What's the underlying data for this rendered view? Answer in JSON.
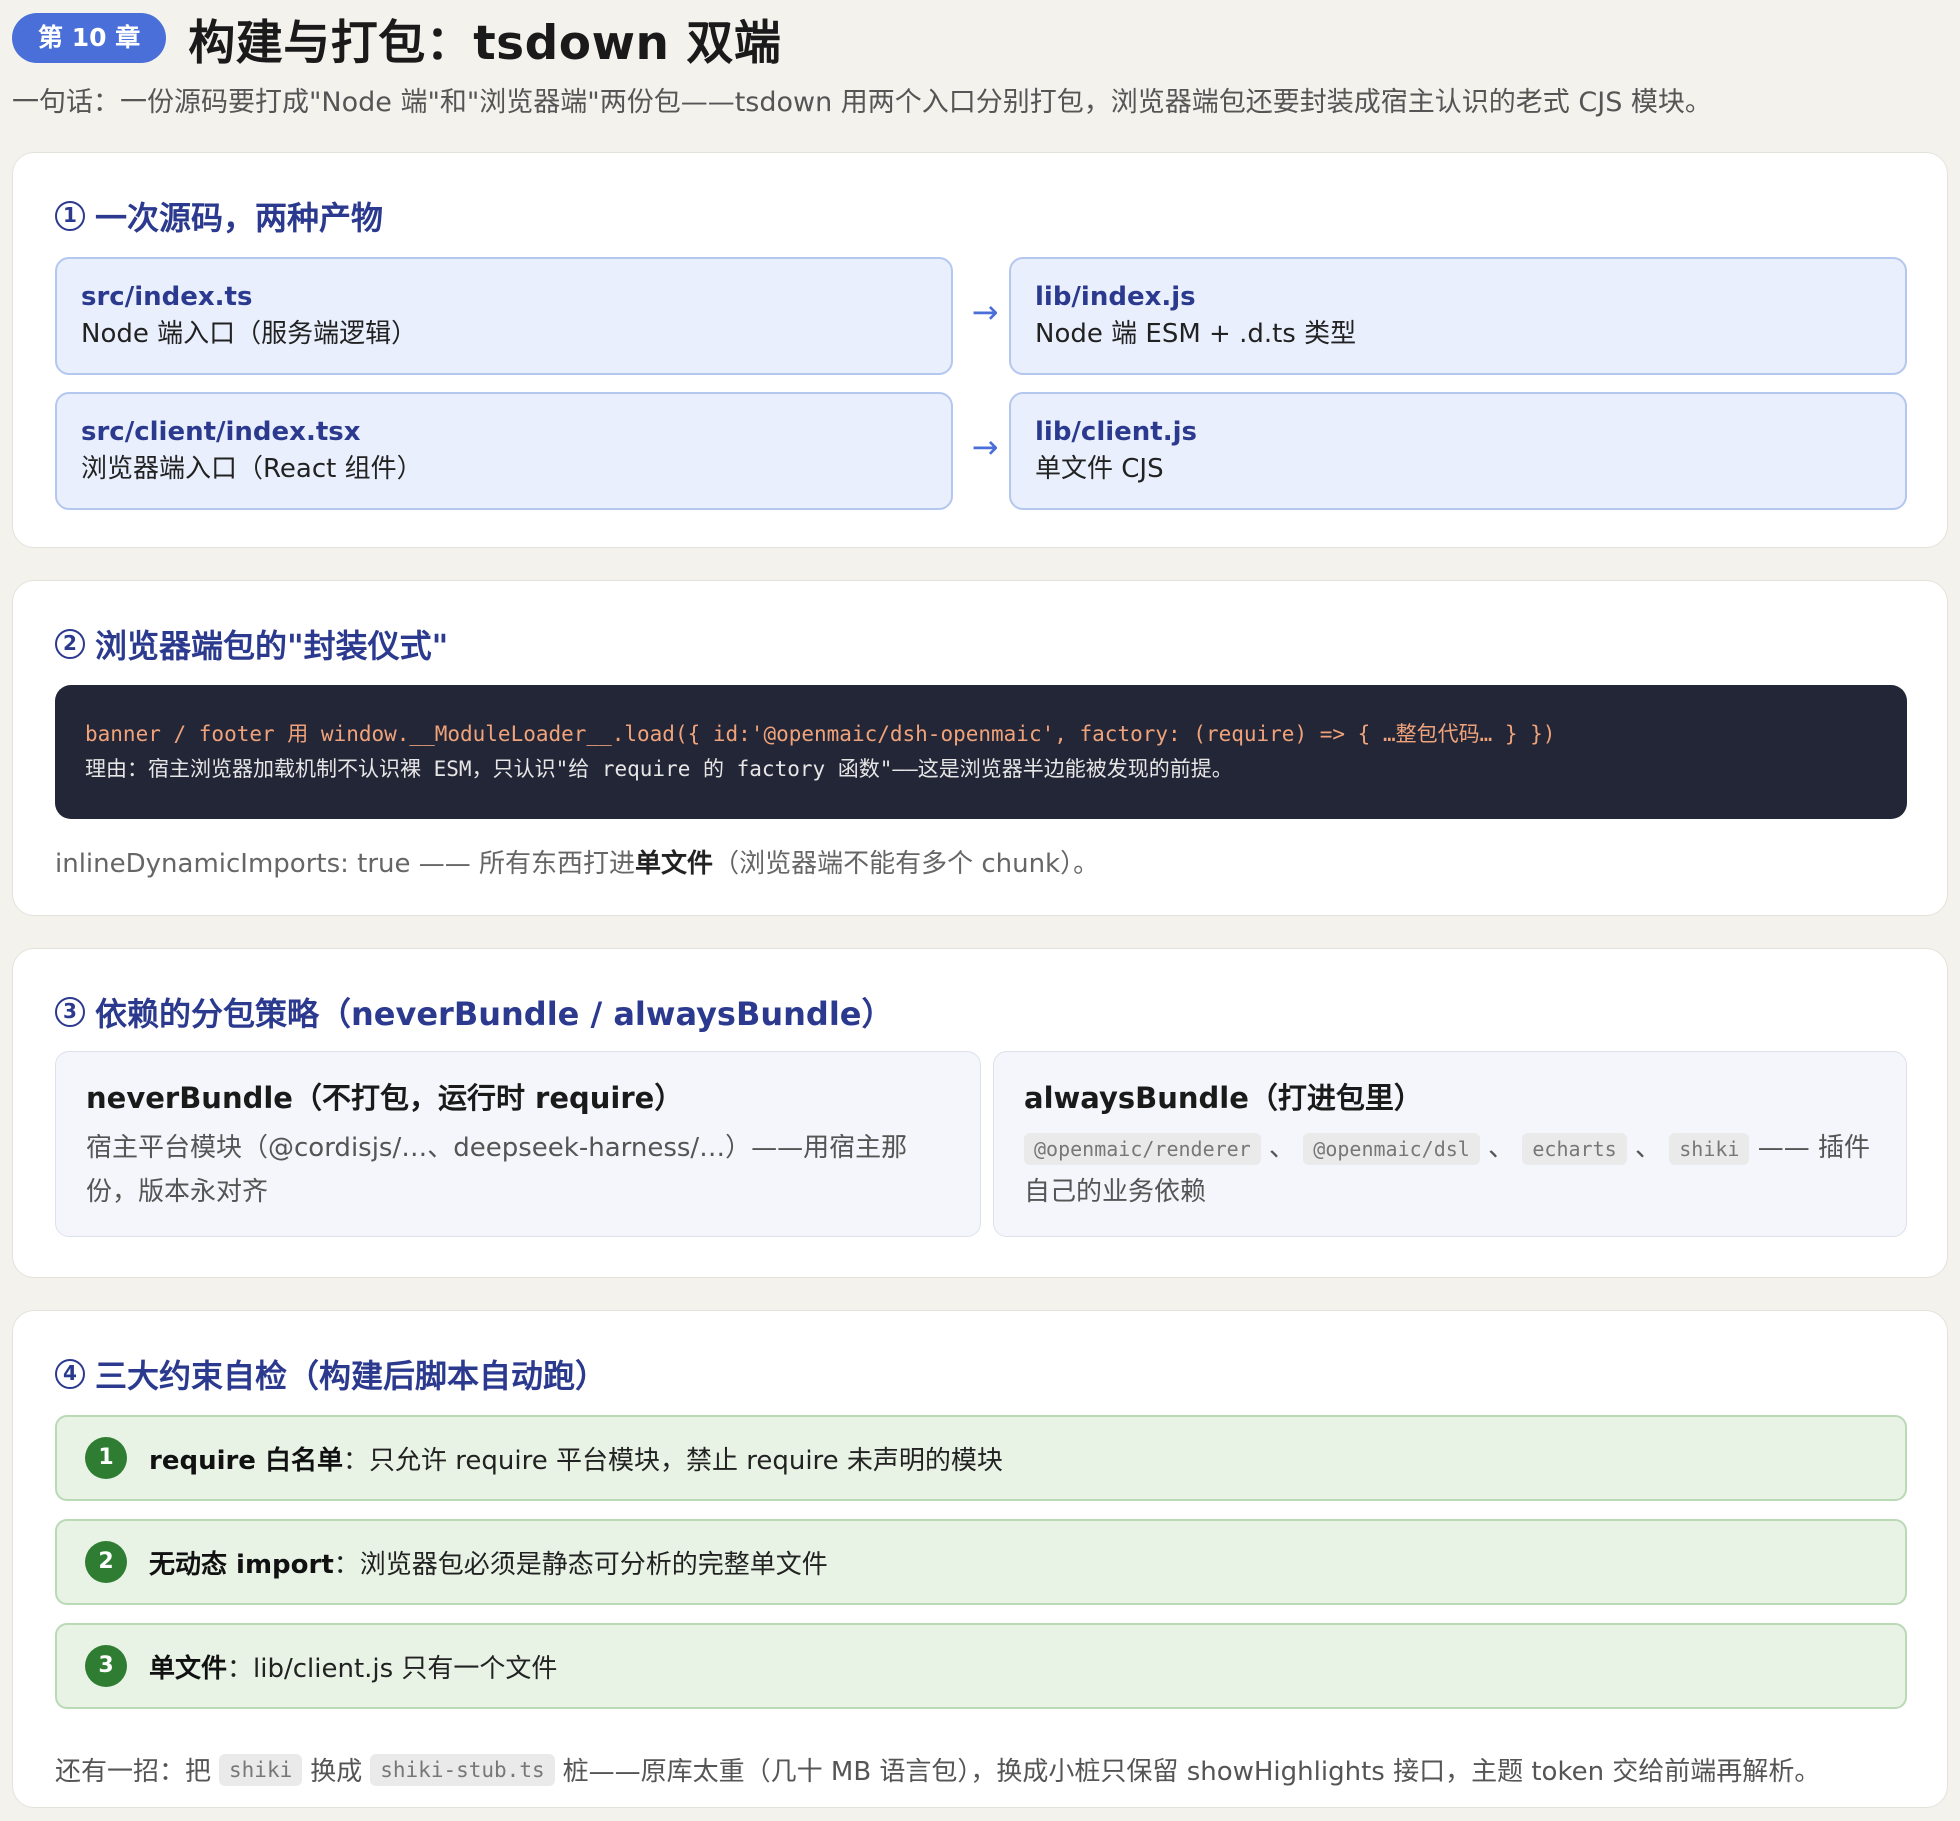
{
  "header": {
    "chapter_badge": "第 10 章",
    "title": "构建与打包：tsdown 双端",
    "subtitle": "一句话：一份源码要打成\"Node 端\"和\"浏览器端\"两份包——tsdown 用两个入口分别打包，浏览器端包还要封装成宿主认识的老式 CJS 模块。"
  },
  "section1": {
    "num": "1",
    "title": "一次源码，两种产物",
    "arrow": "→",
    "rows": [
      {
        "src_path": "src/index.ts",
        "src_desc": "Node 端入口（服务端逻辑）",
        "out_path": "lib/index.js",
        "out_desc": "Node 端 ESM + .d.ts 类型"
      },
      {
        "src_path": "src/client/index.tsx",
        "src_desc": "浏览器端入口（React 组件）",
        "out_path": "lib/client.js",
        "out_desc": "单文件 CJS"
      }
    ]
  },
  "section2": {
    "num": "2",
    "title": "浏览器端包的\"封装仪式\"",
    "code_line1": "banner / footer 用 window.__ModuleLoader__.load({ id:'@openmaic/dsh-openmaic', factory: (require) => { …整包代码… } })",
    "code_line2": "理由：宿主浏览器加载机制不认识裸 ESM，只认识\"给 require 的 factory 函数\"——这是浏览器半边能被发现的前提。",
    "note_prefix": "inlineDynamicImports: true —— 所有东西打进",
    "note_bold": "单文件",
    "note_suffix": "（浏览器端不能有多个 chunk）。"
  },
  "section3": {
    "num": "3",
    "title": "依赖的分包策略（neverBundle / alwaysBundle）",
    "never": {
      "title": "neverBundle（不打包，运行时 require）",
      "body": "宿主平台模块（@cordisjs/…、deepseek-harness/…）——用宿主那份，版本永对齐"
    },
    "always": {
      "title": "alwaysBundle（打进包里）",
      "chips": [
        "@openmaic/renderer",
        "@openmaic/dsl",
        "echarts",
        "shiki"
      ],
      "separator": "、",
      "suffix": "—— 插件自己的业务依赖"
    }
  },
  "section4": {
    "num": "4",
    "title": "三大约束自检（构建后脚本自动跑）",
    "rules": [
      {
        "num": "1",
        "bold": "require 白名单",
        "text": "：只允许 require 平台模块，禁止 require 未声明的模块"
      },
      {
        "num": "2",
        "bold": "无动态 import",
        "text": "：浏览器包必须是静态可分析的完整单文件"
      },
      {
        "num": "3",
        "bold": "单文件",
        "text": "：lib/client.js 只有一个文件"
      }
    ],
    "extra_prefix": "还有一招：把",
    "extra_chip1": "shiki",
    "extra_mid": "换成",
    "extra_chip2": "shiki-stub.ts",
    "extra_suffix": "桩——原库太重（几十 MB 语言包），换成小桩只保留 showHighlights 接口，主题 token 交给前端再解析。"
  }
}
